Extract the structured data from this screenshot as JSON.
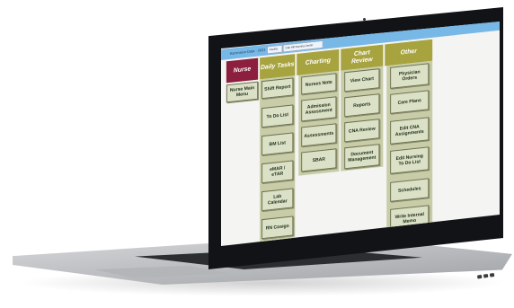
{
  "app": {
    "logo_text": "Ascension Data · 2021",
    "header_box_1": "Facility",
    "header_box_2": "Oak Hill Nursing Center",
    "accent_color": "#77b8e6",
    "category_color": "#a7a33f",
    "active_category_color": "#8b1f3d",
    "button_color": "#dbe1c6"
  },
  "categories": [
    {
      "label": "Nurse",
      "active": true
    },
    {
      "label": "Daily Tasks",
      "active": false
    },
    {
      "label": "Charting",
      "active": false
    },
    {
      "label": "Chart Review",
      "active": false
    },
    {
      "label": "Other",
      "active": false
    }
  ],
  "columns": {
    "nurse": [
      "Nurse Main Menu"
    ],
    "daily_tasks": [
      "Shift Report",
      "To Do List",
      "BM List",
      "eMAR / eTAR",
      "Lab Calendar",
      "RN Cosign"
    ],
    "charting": [
      "Nurses Note",
      "Admission Assessment",
      "Assessments",
      "SBAR"
    ],
    "chart_review": [
      "View Chart",
      "Reports",
      "CNA Review",
      "Document Management"
    ],
    "other": [
      "Physician Orders",
      "Care Plans",
      "Edit CNA Assignments",
      "Edit Nursing To Do List",
      "Schedules",
      "Write Internal Memo"
    ]
  }
}
